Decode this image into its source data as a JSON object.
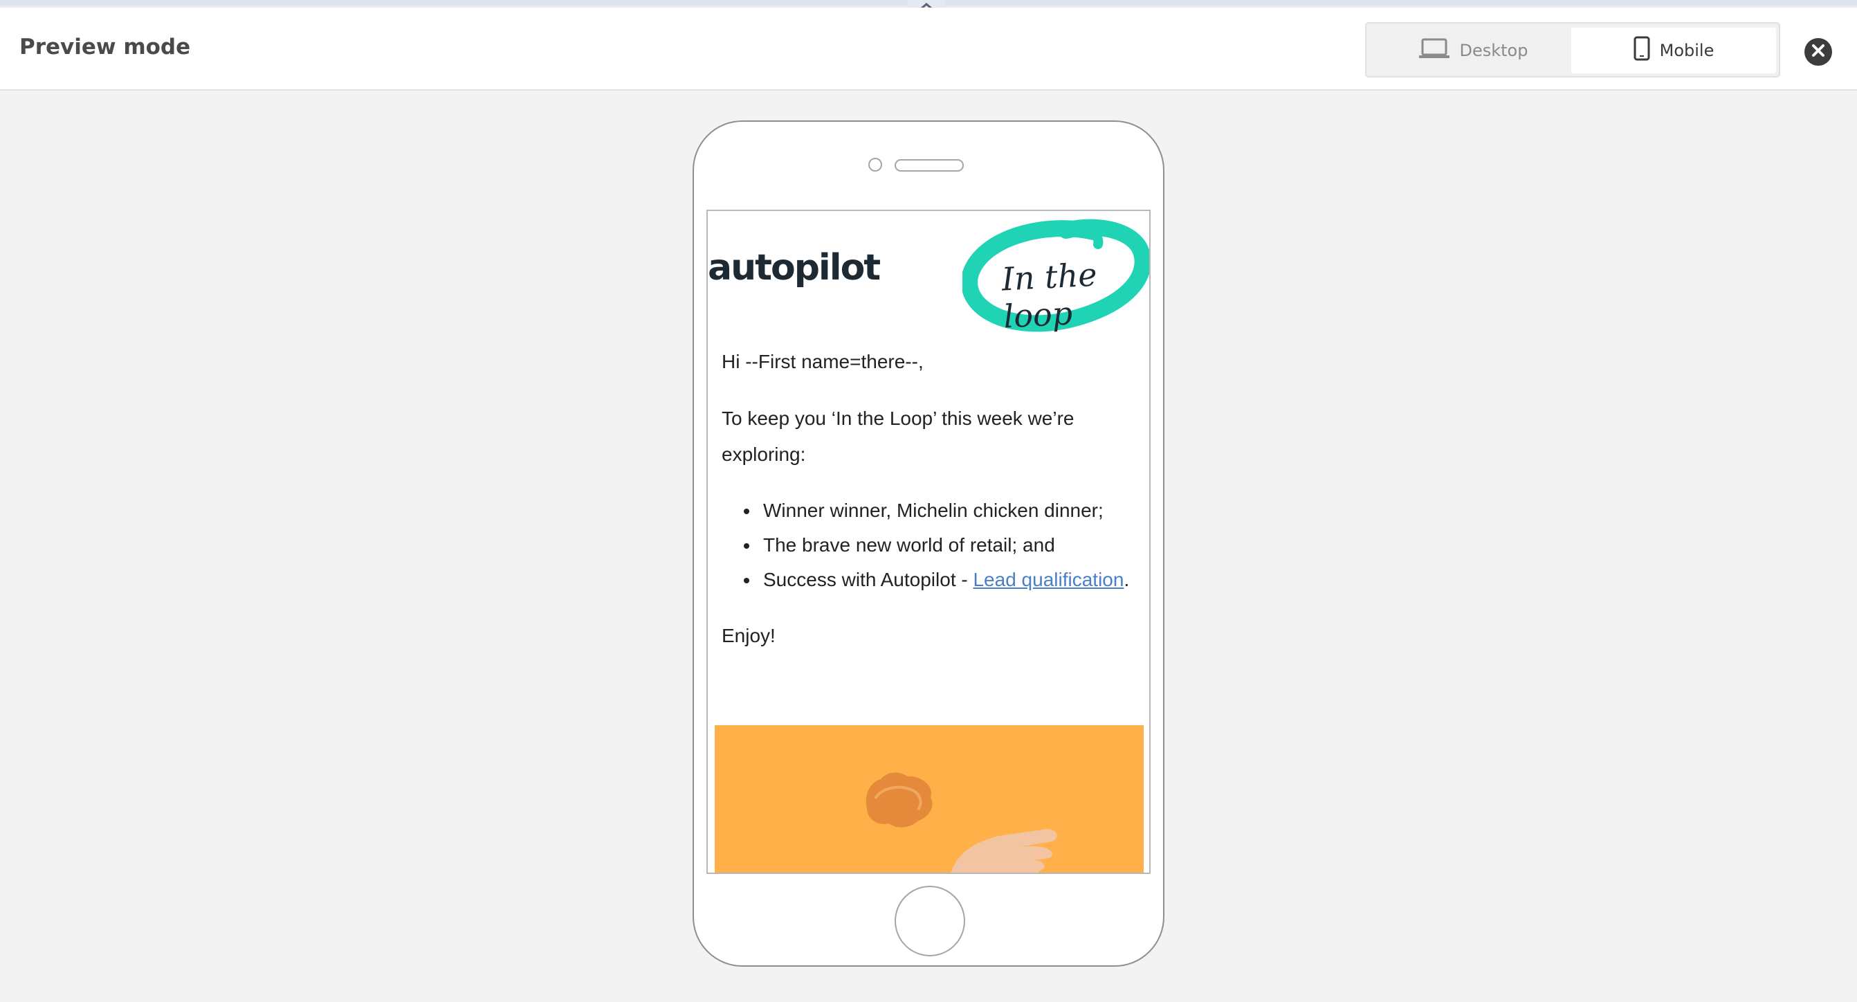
{
  "header": {
    "title": "Preview mode",
    "toggle": {
      "desktop_label": "Desktop",
      "mobile_label": "Mobile",
      "selected": "Mobile"
    }
  },
  "icons": {
    "collapse": "chevron-up-icon",
    "desktop": "laptop-icon",
    "mobile": "phone-icon",
    "close": "close-icon"
  },
  "email": {
    "logo_text": "autopilot",
    "badge_text": "In the loop",
    "greeting": "Hi --First name=there--,",
    "intro": "To keep you ‘In the Loop’ this week we’re exploring:",
    "bullets": {
      "item1": "Winner winner, Michelin chicken dinner;",
      "item2": "The brave new world of retail; and",
      "item3_prefix": "Success with Autopilot - ",
      "item3_link": "Lead qualification",
      "item3_suffix": "."
    },
    "signoff": "Enjoy!"
  },
  "colors": {
    "accent_teal": "#1fd3b4",
    "hero_orange": "#ffb049",
    "link_blue": "#4a7fc8"
  }
}
